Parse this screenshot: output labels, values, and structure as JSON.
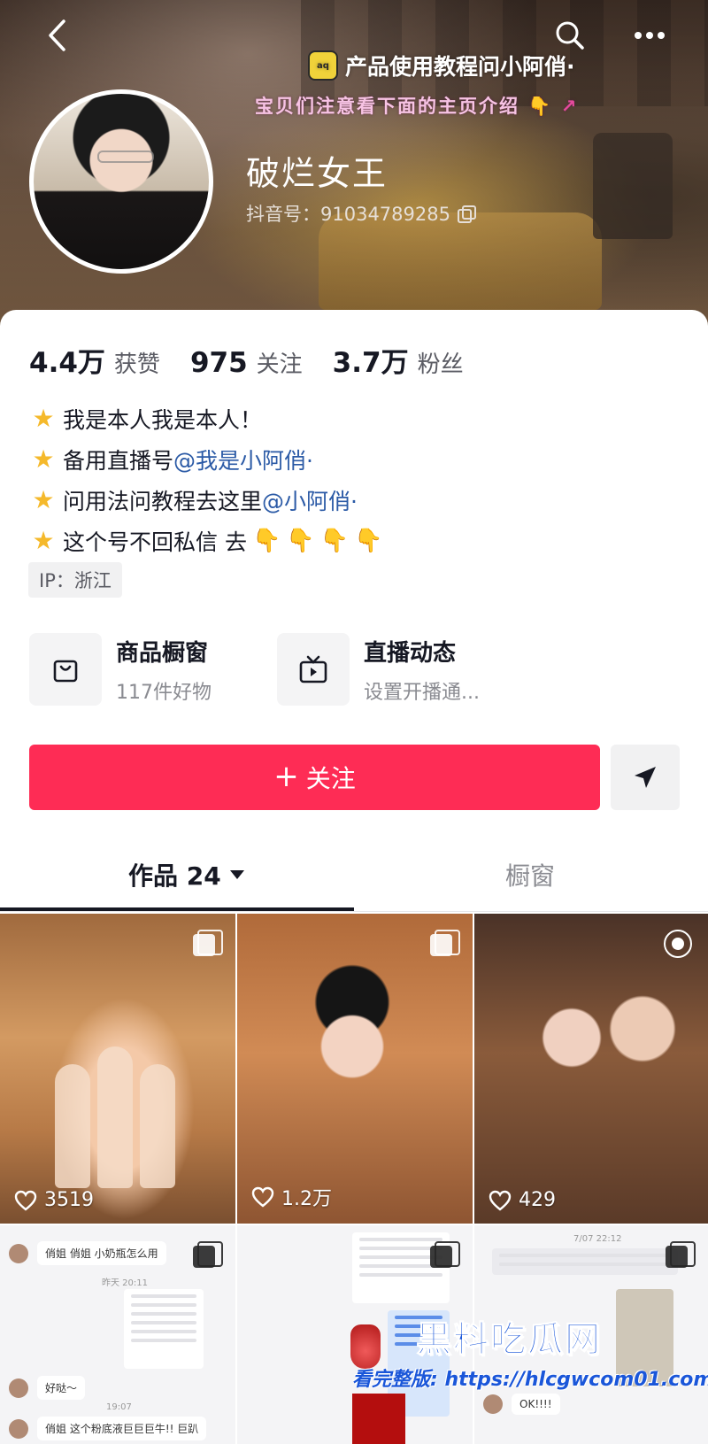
{
  "header": {
    "back_icon": "chevron-left-icon",
    "search_icon": "search-icon",
    "more_icon": "more-horizontal-icon",
    "promo_line1": "产品使用教程问小阿俏·",
    "promo_line2": "宝贝们注意看下面的主页介绍",
    "promo_icon_text": "aq"
  },
  "profile": {
    "name": "破烂女王",
    "douyin_id": "抖音号：91034789285"
  },
  "stats": [
    {
      "num": "4.4万",
      "label": "获赞"
    },
    {
      "num": "975",
      "label": "关注"
    },
    {
      "num": "3.7万",
      "label": "粉丝"
    }
  ],
  "bio": {
    "line1": "我是本人我是本人！",
    "line2_text": "备用直播号 ",
    "line2_mention": "@我是小阿俏·",
    "line3_text": "问用法问教程去这里 ",
    "line3_mention": "@小阿俏·",
    "line4_text": "这个号不回私信 去",
    "line4_hands": "👇👇👇👇"
  },
  "ip": "IP：浙江",
  "entries": {
    "shop_title": "商品橱窗",
    "shop_sub": "117件好物",
    "live_title": "直播动态",
    "live_sub": "设置开播通..."
  },
  "actions": {
    "follow_label": "关注",
    "follow_plus": "+"
  },
  "tabs": {
    "works_label": "作品 24",
    "window_label": "橱窗"
  },
  "videos": [
    {
      "likes": "3519"
    },
    {
      "likes": "1.2万"
    },
    {
      "likes": "429"
    }
  ],
  "chat_cells": {
    "c4_msg1": "俏姐 俏姐 小奶瓶怎么用",
    "c4_msg2": "好哒～",
    "c4_msg3": "俏姐 这个粉底液巨巨巨牛!! 巨趴",
    "c4_time1": "昨天 20:11",
    "c4_time2": "19:07",
    "c6_time": "7/07 22:12",
    "c6_msg": "OK!!!!"
  },
  "watermark": {
    "title": "黑料吃瓜网",
    "sub": "看完整版: https://hlcgwcom01.com"
  },
  "colors": {
    "follow": "#fe2c55",
    "mention": "#2b5aa6",
    "star": "#f5b92b"
  }
}
